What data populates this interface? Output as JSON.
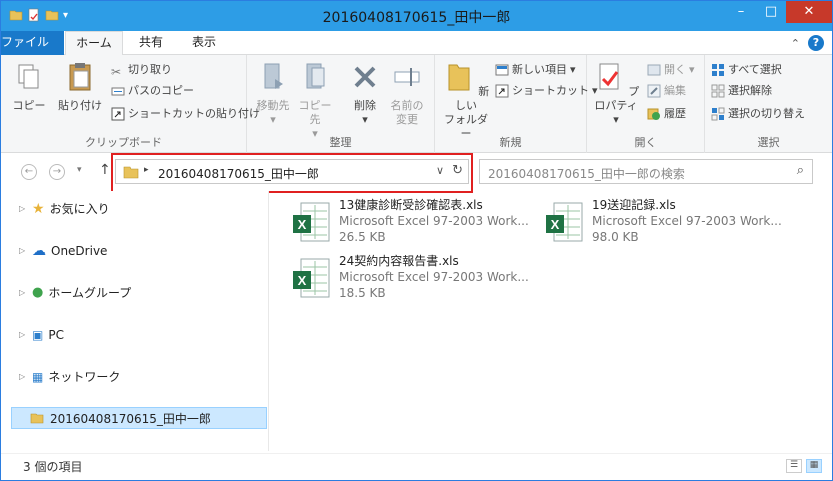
{
  "window": {
    "title": "20160408170615_田中一郎",
    "minimize": "–",
    "maximize": "□",
    "close": "✕"
  },
  "tabs": {
    "file": "ファイル",
    "home": "ホーム",
    "share": "共有",
    "view": "表示"
  },
  "ribbon": {
    "clipboard": {
      "label": "クリップボード",
      "copy": "コピー",
      "paste": "貼り付け",
      "cut": "切り取り",
      "copy_path": "パスのコピー",
      "paste_shortcut": "ショートカットの貼り付け"
    },
    "organize": {
      "label": "整理",
      "move_to": "移動先",
      "copy_to": "コピー先",
      "delete": "削除",
      "rename_1": "名前の",
      "rename_2": "変更"
    },
    "new": {
      "label": "新規",
      "new_folder_1": "新しい",
      "new_folder_2": "フォルダー",
      "new_item": "新しい項目",
      "shortcut": "ショートカット"
    },
    "open": {
      "label": "開く",
      "properties": "プロパティ",
      "open": "開く",
      "edit": "編集",
      "history": "履歴"
    },
    "select": {
      "label": "選択",
      "select_all": "すべて選択",
      "select_none": "選択解除",
      "invert": "選択の切り替え"
    }
  },
  "address": {
    "path": "20160408170615_田中一郎",
    "search_placeholder": "20160408170615_田中一郎の検索"
  },
  "nav": {
    "favorites": "お気に入り",
    "onedrive": "OneDrive",
    "homegroup": "ホームグループ",
    "pc": "PC",
    "network": "ネットワーク",
    "current_folder": "20160408170615_田中一郎"
  },
  "files": [
    {
      "name": "13健康診断受診確認表.xls",
      "type": "Microsoft Excel 97-2003 Work...",
      "size": "26.5 KB"
    },
    {
      "name": "19送迎記録.xls",
      "type": "Microsoft Excel 97-2003 Work...",
      "size": "98.0 KB"
    },
    {
      "name": "24契約内容報告書.xls",
      "type": "Microsoft Excel 97-2003 Work...",
      "size": "18.5 KB"
    }
  ],
  "status": {
    "item_count": "3 個の項目"
  },
  "colors": {
    "titlebar": "#2d9de6",
    "file_tab": "#1979ca",
    "close": "#c7392a",
    "highlight": "#e02020",
    "excel": "#1f7244"
  }
}
